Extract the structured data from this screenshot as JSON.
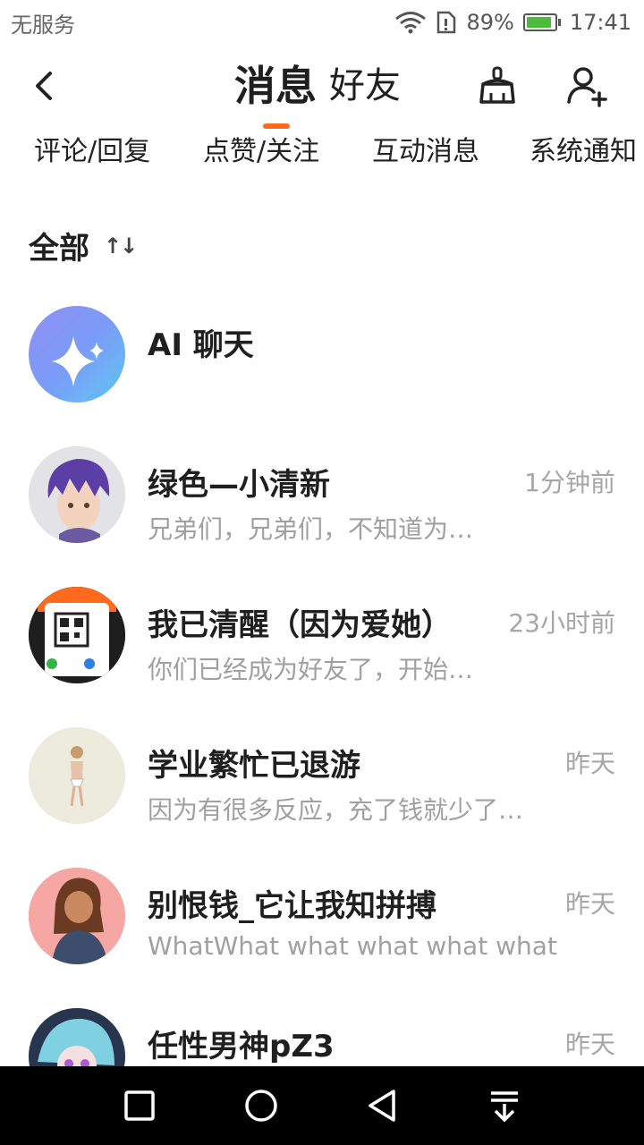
{
  "status_bar": {
    "carrier": "无服务",
    "battery_percent": "89%",
    "battery_level": 0.89,
    "time": "17:41",
    "wifi_icon": "wifi-icon",
    "sim_icon": "sim-alert-icon"
  },
  "header": {
    "tab_messages": "消息",
    "tab_friends": "好友",
    "active_tab": "消息",
    "accent_color": "#ff6b1a"
  },
  "categories": [
    "评论/回复",
    "点赞/关注",
    "互动消息",
    "系统通知"
  ],
  "section": {
    "title": "全部",
    "sort_icon": "sort-icon"
  },
  "items": [
    {
      "name": "AI 聊天",
      "time": "",
      "preview": ""
    },
    {
      "name": "绿色—小清新",
      "time": "1分钟前",
      "preview": "兄弟们，兄弟们，不知道为…"
    },
    {
      "name": "我已清醒（因为爱她）",
      "time": "23小时前",
      "preview": "你们已经成为好友了，开始…"
    },
    {
      "name": "学业繁忙已退游",
      "time": "昨天",
      "preview": "因为有很多反应，充了钱就少了…"
    },
    {
      "name": "别恨钱_它让我知拼搏",
      "time": "昨天",
      "preview": "WhatWhat what what what what"
    },
    {
      "name": "任性男神pZ3",
      "time": "昨天",
      "preview": ""
    }
  ]
}
